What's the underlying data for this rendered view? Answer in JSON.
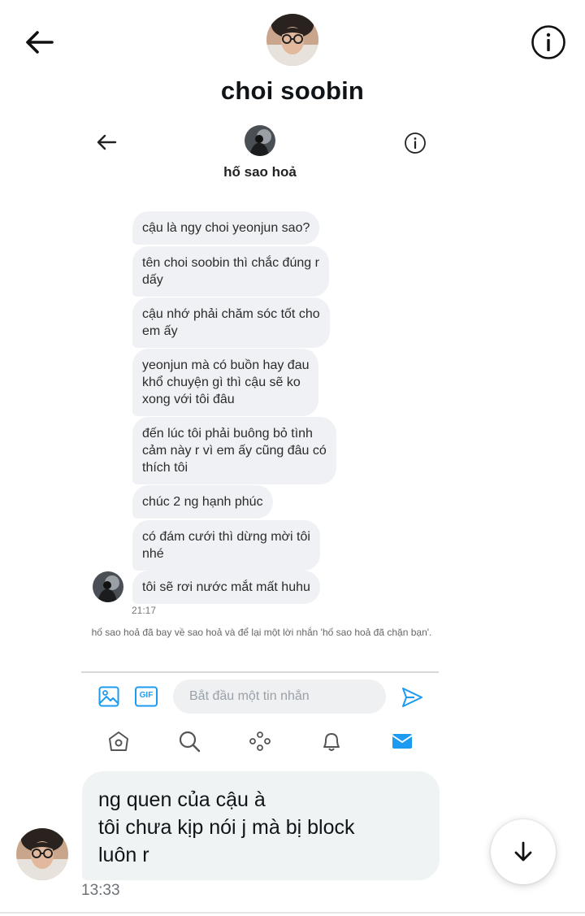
{
  "header": {
    "title": "choi soobin",
    "back_icon": "arrow-left-icon",
    "info_icon": "info-circle-icon"
  },
  "embedded_screenshot": {
    "header": {
      "title": "hố sao hoả",
      "back_icon": "arrow-left-icon",
      "info_icon": "info-circle-icon"
    },
    "messages": [
      {
        "text": "cậu là ngy choi yeonjun sao?"
      },
      {
        "text": "tên choi soobin thì chắc đúng r\ndấy"
      },
      {
        "text": "cậu nhớ phải chăm sóc tốt cho\nem ấy"
      },
      {
        "text": "yeonjun mà có buồn hay đau\nkhổ chuyện gì thì cậu sẽ ko\nxong với tôi đâu"
      },
      {
        "text": "đến lúc tôi phải buông bỏ tình\ncảm này r vì em ấy cũng đâu có\nthích tôi"
      },
      {
        "text": "chúc 2 ng hạnh phúc"
      },
      {
        "text": "có đám cưới thì dừng mời tôi\nnhé"
      },
      {
        "text": "tôi sẽ rơi nước mắt mất huhu"
      }
    ],
    "timestamp": "21:17",
    "notice": "hố sao hoả đã bay về sao hoả và để lại một lời nhắn 'hố sao hoả đã chặn bạn'.",
    "composer": {
      "placeholder": "Bắt đầu một tin nhắn",
      "media_icon": "image-icon",
      "gif_icon": "gif-icon",
      "gif_label": "GIF",
      "send_icon": "send-icon"
    },
    "nav": [
      "home-icon",
      "search-icon",
      "spaces-icon",
      "bell-icon",
      "mail-icon"
    ],
    "accent_color": "#1d9bf0"
  },
  "outgoing_message": {
    "lines": [
      "ng quen của cậu à",
      "tôi chưa kịp nói j mà bị block",
      "luôn r"
    ],
    "timestamp": "13:33"
  },
  "scroll_button_icon": "arrow-down-icon"
}
